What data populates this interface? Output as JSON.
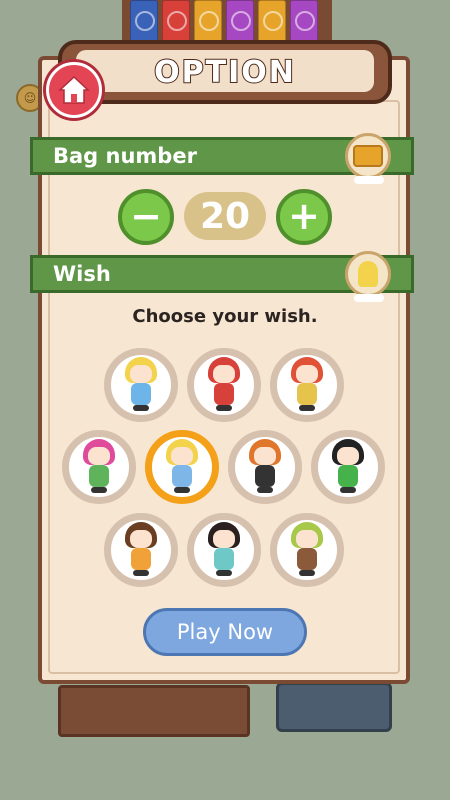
{
  "screen": {
    "title": "OPTION"
  },
  "bag_number": {
    "label": "Bag number",
    "value": "20",
    "minus_label": "−",
    "plus_label": "+"
  },
  "wish": {
    "label": "Wish",
    "prompt": "Choose your wish."
  },
  "wishes": [
    {
      "name": "bee-girl",
      "hair": "#f3d24c",
      "body": "#6db4e8",
      "selected": false
    },
    {
      "name": "red-girl",
      "hair": "#d8403a",
      "body": "#d8403a",
      "selected": false
    },
    {
      "name": "red-hood-girl",
      "hair": "#e05238",
      "body": "#e6c34a",
      "selected": false
    },
    {
      "name": "pink-girl",
      "hair": "#e04a9a",
      "body": "#5fb35a",
      "selected": false
    },
    {
      "name": "blonde-girl",
      "hair": "#f3d24c",
      "body": "#7fb6e8",
      "selected": true
    },
    {
      "name": "panda-girl",
      "hair": "#e0752c",
      "body": "#333333",
      "selected": false
    },
    {
      "name": "frog-girl",
      "hair": "#222222",
      "body": "#46b24c",
      "selected": false
    },
    {
      "name": "tiger-girl",
      "hair": "#6a3e22",
      "body": "#f0a238",
      "selected": false
    },
    {
      "name": "orange-girl",
      "hair": "#2a2020",
      "body": "#6fc8c8",
      "selected": false
    },
    {
      "name": "bear-girl",
      "hair": "#a8c84a",
      "body": "#8a5a3a",
      "selected": false
    }
  ],
  "play_button": {
    "label": "Play Now"
  },
  "colors": {
    "accent_green": "#5f9648",
    "selected_ring": "#f4a018",
    "play_blue": "#7ea7e0"
  }
}
